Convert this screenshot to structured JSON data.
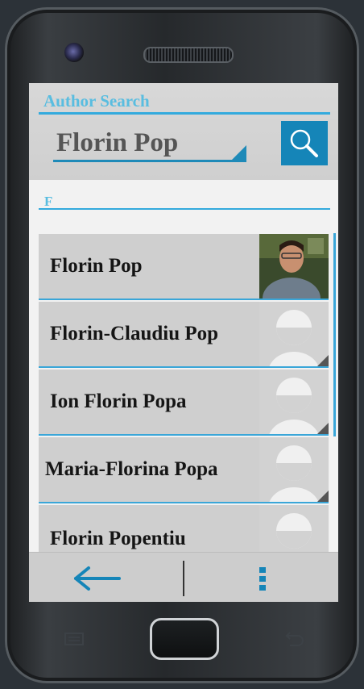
{
  "header": {
    "title": "Author Search",
    "search_value": "Florin Pop"
  },
  "section": {
    "letter": "F"
  },
  "authors": [
    {
      "name": "Florin Pop",
      "avatar": "photo"
    },
    {
      "name": "Florin-Claudiu Pop",
      "avatar": "placeholder-avatar-icon"
    },
    {
      "name": "Ion Florin Popa",
      "avatar": "placeholder-avatar-icon"
    },
    {
      "name": "Maria-Florina Popa",
      "avatar": "placeholder-avatar-icon"
    },
    {
      "name": "Florin Popentiu",
      "avatar": "placeholder-avatar-icon"
    }
  ],
  "navigation": {
    "back_icon": "back-arrow-icon",
    "menu_icon": "overflow-menu-icon"
  },
  "colors": {
    "accent": "#33aadd",
    "button": "#1585b8",
    "title": "#59bde0"
  }
}
